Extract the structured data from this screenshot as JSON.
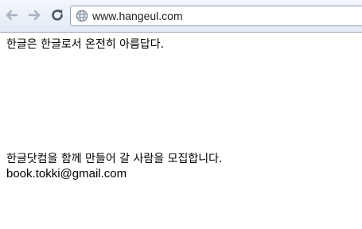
{
  "browser": {
    "url": "www.hangeul.com",
    "icons": {
      "back": "back-arrow-icon",
      "forward": "forward-arrow-icon",
      "reload": "reload-icon",
      "site": "globe-icon"
    }
  },
  "page": {
    "intro": "한글은 한글로서 온전히 아름답다.",
    "recruit": "한글닷컴을 함께 만들어 갈 사람을 모집합니다.",
    "email": "book.tokki@gmail.com"
  },
  "colors": {
    "toolbar_top": "#f3f6fb",
    "toolbar_bottom": "#e4ebf5",
    "nav_disabled": "#a9b3bf",
    "reload": "#4a5563"
  }
}
